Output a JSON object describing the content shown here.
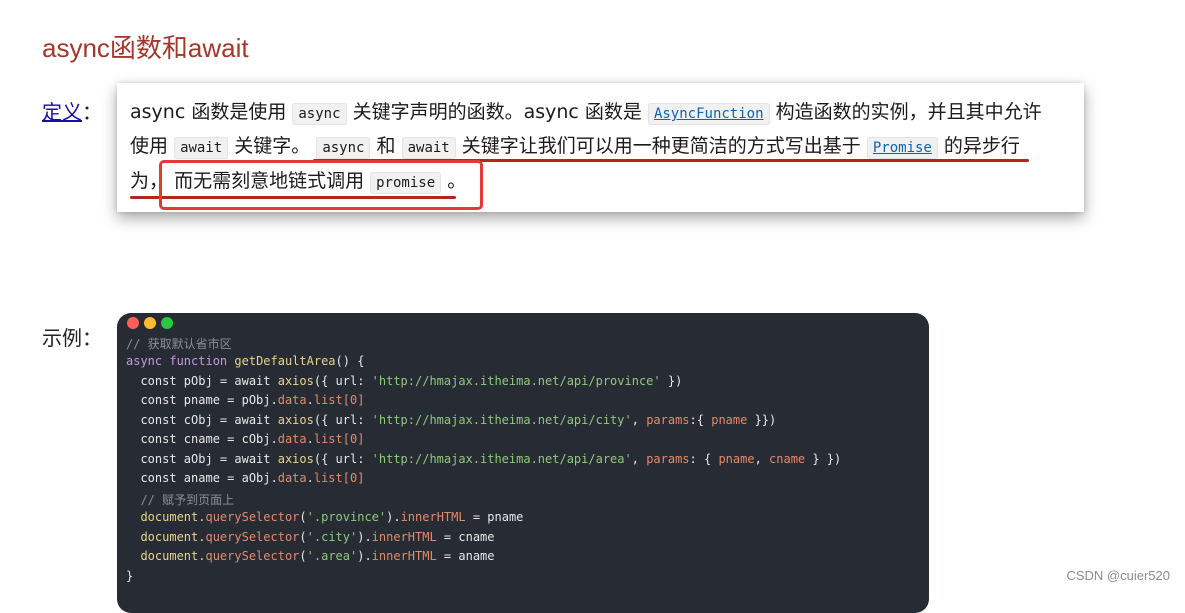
{
  "title": "async函数和await",
  "definition": {
    "label": "定义",
    "colon": "：",
    "line1": {
      "t1": "async 函数是使用",
      "c1": "async",
      "t2": "关键字声明的函数。async 函数是",
      "link1": "AsyncFunction",
      "t3": "构造函数的实例，并且其中允许"
    },
    "line2": {
      "t1": "使用",
      "c1": "await",
      "t2": "关键字。",
      "c2": "async",
      "t3": "和",
      "c3": "await",
      "t4": "关键字让我们可以用一种更简洁的方式写出基于",
      "link1": "Promise",
      "t5": "的异步行"
    },
    "line3": {
      "t1": "为，",
      "t2": "而无需刻意地链式调用",
      "c1": "promise",
      "t3": "。"
    }
  },
  "example": {
    "label": "示例：",
    "code": {
      "c0": "// 获取默认省市区",
      "l1_kw": "async function",
      "l1_fn": "getDefaultArea",
      "l1_rest": "() {",
      "l2_a": "  const pObj = await ",
      "l2_fn": "axios",
      "l2_b": "({ url: ",
      "l2_str": "'http://hmajax.itheima.net/api/province'",
      "l2_c": " })",
      "l3_a": "  const pname = pObj.",
      "l3_p1": "data",
      "l3_dot": ".",
      "l3_p2": "list",
      "l3_i": "[0]",
      "l4_a": "  const cObj = await ",
      "l4_fn": "axios",
      "l4_b": "({ url: ",
      "l4_str": "'http://hmajax.itheima.net/api/city'",
      "l4_c": ", ",
      "l4_p": "params",
      "l4_d": ":{ ",
      "l4_v": "pname",
      "l4_e": " }})",
      "l5_a": "  const cname = cObj.",
      "l5_p1": "data",
      "l5_dot": ".",
      "l5_p2": "list",
      "l5_i": "[0]",
      "l6_a": "  const aObj = await ",
      "l6_fn": "axios",
      "l6_b": "({ url: ",
      "l6_str": "'http://hmajax.itheima.net/api/area'",
      "l6_c": ", ",
      "l6_p": "params",
      "l6_d": ": { ",
      "l6_v1": "pname",
      "l6_e": ", ",
      "l6_v2": "cname",
      "l6_f": " } })",
      "l7_a": "  const aname = aObj.",
      "l7_p1": "data",
      "l7_dot": ".",
      "l7_p2": "list",
      "l7_i": "[0]",
      "c1": "  // 赋予到页面上",
      "l8_p": "  document.",
      "l8_m": "querySelector",
      "l8_b": "(",
      "l8_str": "'.province'",
      "l8_c": ").",
      "l8_p2": "innerHTML",
      "l8_d": " = pname",
      "l9_p": "  document.",
      "l9_m": "querySelector",
      "l9_b": "(",
      "l9_str": "'.city'",
      "l9_c": ").",
      "l9_p2": "innerHTML",
      "l9_d": " = cname",
      "l10_p": "  document.",
      "l10_m": "querySelector",
      "l10_b": "(",
      "l10_str": "'.area'",
      "l10_c": ").",
      "l10_p2": "innerHTML",
      "l10_d": " = aname",
      "close": "}"
    }
  },
  "watermark": "CSDN @cuier520",
  "colors": {
    "title": "#a3372a",
    "annotation_red": "#e53935",
    "underline_red": "#b1271b",
    "code_bg": "#272b34"
  }
}
